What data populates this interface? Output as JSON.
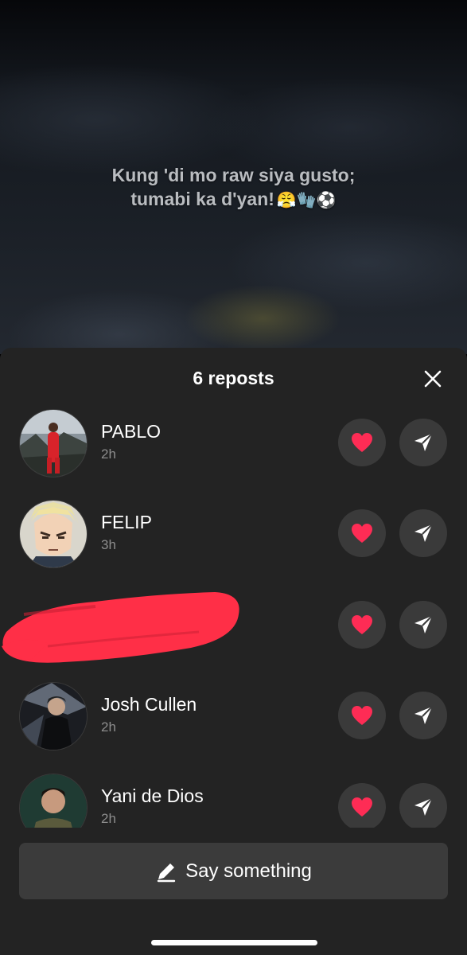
{
  "video": {
    "caption_line1": "Kung 'di mo raw siya gusto;",
    "caption_line2": "tumabi ka d'yan!",
    "caption_emojis": "😤🧤⚽"
  },
  "sheet": {
    "title": "6 reposts",
    "close_icon": "close-icon"
  },
  "reposts": [
    {
      "name": "PABLO",
      "time": "2h",
      "avatar": "avatar-red-suit"
    },
    {
      "name": "FELIP",
      "time": "3h",
      "avatar": "avatar-anime"
    },
    {
      "name": "",
      "time": "",
      "avatar": "redacted"
    },
    {
      "name": "Josh Cullen",
      "time": "2h",
      "avatar": "avatar-dark"
    },
    {
      "name": "Yani de Dios",
      "time": "2h",
      "avatar": "avatar-portrait"
    }
  ],
  "actions": {
    "heart_icon": "heart-icon",
    "send_icon": "send-icon"
  },
  "compose": {
    "label": "Say something",
    "icon": "pencil-icon"
  },
  "colors": {
    "sheet_bg": "#232323",
    "button_bg": "#3a3a3a",
    "heart": "#fe2c55",
    "redaction": "#ff2f47"
  }
}
